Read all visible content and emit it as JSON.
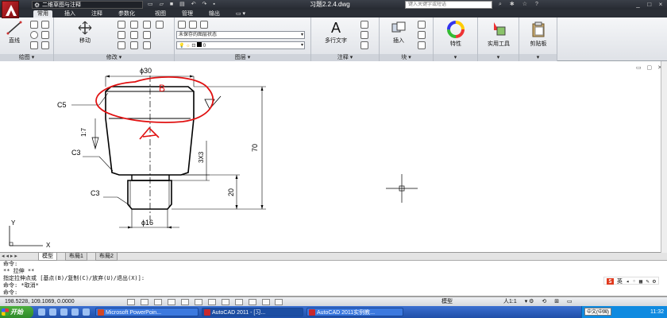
{
  "titlebar": {
    "workspace": "二维草图与注释",
    "document_title": "习题2.2.4.dwg",
    "search_placeholder": "键入关键字或短语",
    "window_buttons": [
      "_",
      "□",
      "×"
    ]
  },
  "ribbon_tabs": [
    "常用",
    "插入",
    "注释",
    "参数化",
    "视图",
    "管理",
    "输出"
  ],
  "ribbon": {
    "draw": {
      "title": "绘图",
      "line_label": "直线"
    },
    "modify": {
      "title": "修改",
      "move_label": "移动"
    },
    "layers": {
      "title": "图层",
      "layer_state": "未保存的图层状态",
      "current_layer": "0"
    },
    "annotation": {
      "title": "注释",
      "mtext_label": "多行文字",
      "a_glyph": "A"
    },
    "block": {
      "title": "块",
      "insert_label": "插入"
    },
    "properties": {
      "label": "特性"
    },
    "utilities": {
      "label": "实用工具"
    },
    "clipboard": {
      "label": "剪贴板"
    }
  },
  "drawing": {
    "dims": {
      "top_diameter": "ϕ30",
      "bottom_diameter": "ϕ16",
      "height_total": "70",
      "height_lower": "20",
      "thread": "3X3",
      "chamfer_top": "C5",
      "chamfer_mid": "C3",
      "chamfer_bottom": "C3",
      "taper": "1:7"
    },
    "handwritten": {
      "top_letter": "B",
      "mid_letter": "A"
    },
    "ucs": {
      "y": "Y",
      "x": "X"
    }
  },
  "layout_tabs": [
    "模型",
    "布局1",
    "布局2"
  ],
  "command_lines": [
    "命令:",
    "** 拉伸 **",
    "指定拉伸点或 [基点(B)/复制(C)/放弃(U)/退出(X)]:",
    "命令: *取消*",
    "命令:"
  ],
  "ime": {
    "logo": "S",
    "lang": "英"
  },
  "statusbar": {
    "coords": "198.5228, 109.1069, 0.0000",
    "model": "模型",
    "scale": "人1:1"
  },
  "taskbar": {
    "start": "开始",
    "tasks": [
      "Microsoft PowerPoin...",
      "AutoCAD 2011 - [习...",
      "AutoCAD 2011实例教..."
    ],
    "lang": "中文(中国)",
    "clock": "11:32"
  },
  "colors": {
    "markup_red": "#e01010",
    "titlebar": "#2b2f36",
    "taskbar": "#2a5ec2"
  }
}
